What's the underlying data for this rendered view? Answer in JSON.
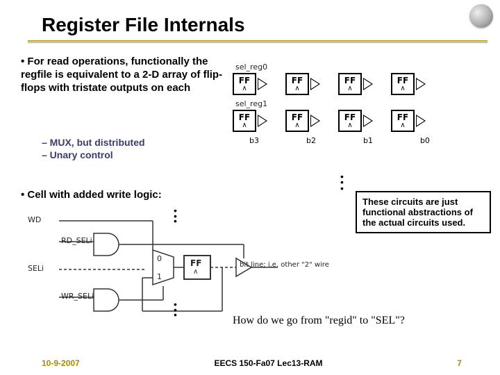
{
  "title": "Register File Internals",
  "bullet1": "For read operations, functionally the regfile is equivalent to a 2-D array of flip-flops with tristate outputs on each",
  "bullet1_sub1": "– MUX, but distributed",
  "bullet1_sub2": "– Unary control",
  "bullet2": "Cell with added write logic:",
  "ff": {
    "sel0": "sel_reg0",
    "sel1": "sel_reg1",
    "ff": "FF",
    "clk": "∧",
    "bits": [
      "b3",
      "b2",
      "b1",
      "b0"
    ]
  },
  "note": "These circuits are just functional abstractions of the actual circuits used.",
  "wcell": {
    "wd": "WD",
    "rdsel": "RD_SELi",
    "sel": "SELi",
    "wrsel": "WR_SELi",
    "mux0": "0",
    "mux1": "1",
    "ff": "FF",
    "clk": "∧",
    "bitline": "bit line; i.e. other \"2\" wire"
  },
  "question": "How do we go from \"regid\" to \"SEL\"?",
  "footer": {
    "date": "10-9-2007",
    "mid": "EECS 150-Fa07 Lec13-RAM",
    "num": "7"
  }
}
